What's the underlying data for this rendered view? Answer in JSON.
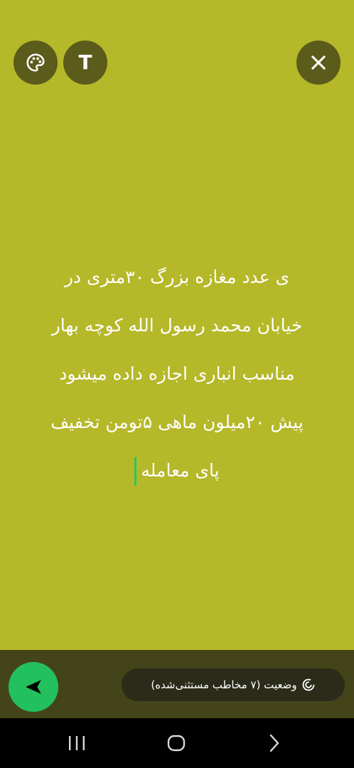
{
  "toolbar": {
    "palette_icon": "palette-icon",
    "text_label": "T",
    "close_icon": "close-icon"
  },
  "status": {
    "lines": [
      "ی عدد مغازه بزرگ ۳۰متری در",
      "خیابان محمد رسول الله کوچه بهار",
      "مناسب انباری  اجازه داده میشود",
      "پیش ۲۰میلون ماهی ۵تومن تخفیف",
      "پای معامله"
    ]
  },
  "footer": {
    "privacy_label": "وضعیت (۷ مخاطب مستثنی‌شده)",
    "send_icon": "send-icon"
  },
  "colors": {
    "background": "#b5b828",
    "bottom_bar": "#44441a",
    "accent": "#22c15e"
  }
}
